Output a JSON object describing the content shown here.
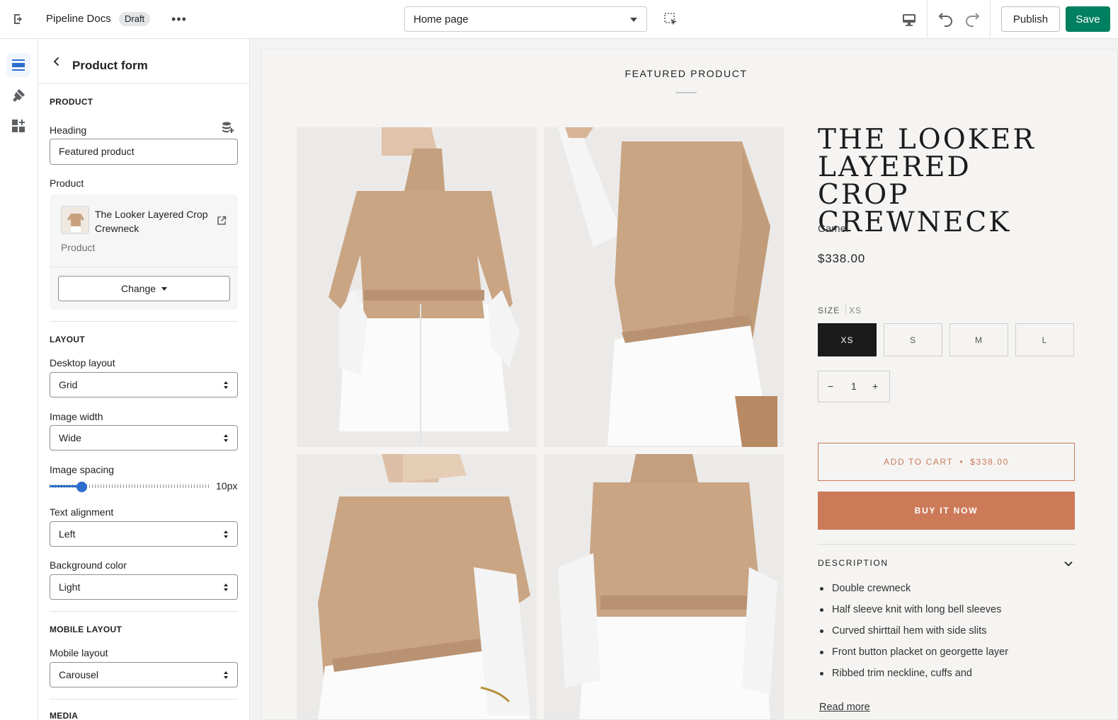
{
  "topbar": {
    "store_name": "Pipeline Docs",
    "status_badge": "Draft",
    "more_label": "•••",
    "page_select": "Home page",
    "publish_label": "Publish",
    "save_label": "Save",
    "icons": [
      "exit-icon",
      "inspector-icon",
      "desktop-icon",
      "undo-icon",
      "redo-icon"
    ]
  },
  "rail": {
    "items": [
      {
        "icon": "sections-icon",
        "active": true
      },
      {
        "icon": "theme-settings-icon",
        "active": false
      },
      {
        "icon": "apps-icon",
        "active": false
      }
    ]
  },
  "sidebar": {
    "title": "Product form",
    "product_section": {
      "title": "PRODUCT",
      "heading_label": "Heading",
      "heading_value": "Featured product",
      "product_label": "Product",
      "product_name": "The Looker Layered Crop Crewneck",
      "product_type": "Product",
      "change_label": "Change"
    },
    "layout_section": {
      "title": "LAYOUT",
      "desktop_layout_label": "Desktop layout",
      "desktop_layout_value": "Grid",
      "image_width_label": "Image width",
      "image_width_value": "Wide",
      "image_spacing_label": "Image spacing",
      "image_spacing_value": "10px",
      "image_spacing_fraction": 0.2,
      "text_alignment_label": "Text alignment",
      "text_alignment_value": "Left",
      "background_color_label": "Background color",
      "background_color_value": "Light"
    },
    "mobile_section": {
      "title": "MOBILE LAYOUT",
      "mobile_layout_label": "Mobile layout",
      "mobile_layout_value": "Carousel"
    },
    "next_section_title": "MEDIA"
  },
  "preview": {
    "section_title": "FEATURED PRODUCT",
    "product_title": "The Looker Layered Crop Crewneck",
    "variant": "Camel",
    "price": "$338.00",
    "size_label": "SIZE",
    "size_selected": "XS",
    "sizes": [
      "XS",
      "S",
      "M",
      "L"
    ],
    "quantity": "1",
    "qty_minus": "−",
    "qty_plus": "+",
    "add_to_cart_label": "ADD TO CART",
    "add_to_cart_sep": "•",
    "add_to_cart_price": "$338.00",
    "buy_now_label": "BUY IT NOW",
    "description_title": "DESCRIPTION",
    "description_items": [
      "Double crewneck",
      "Half sleeve knit with long bell sleeves",
      "Curved shirttail hem with side slits",
      "Front button placket on georgette layer",
      "Ribbed trim neckline, cuffs and"
    ],
    "read_more_label": "Read more"
  },
  "colors": {
    "accent_green": "#008060",
    "accent_blue": "#2c6ecb",
    "buy_button": "#cc7a58",
    "sweater_camel": "#c8a27f"
  }
}
